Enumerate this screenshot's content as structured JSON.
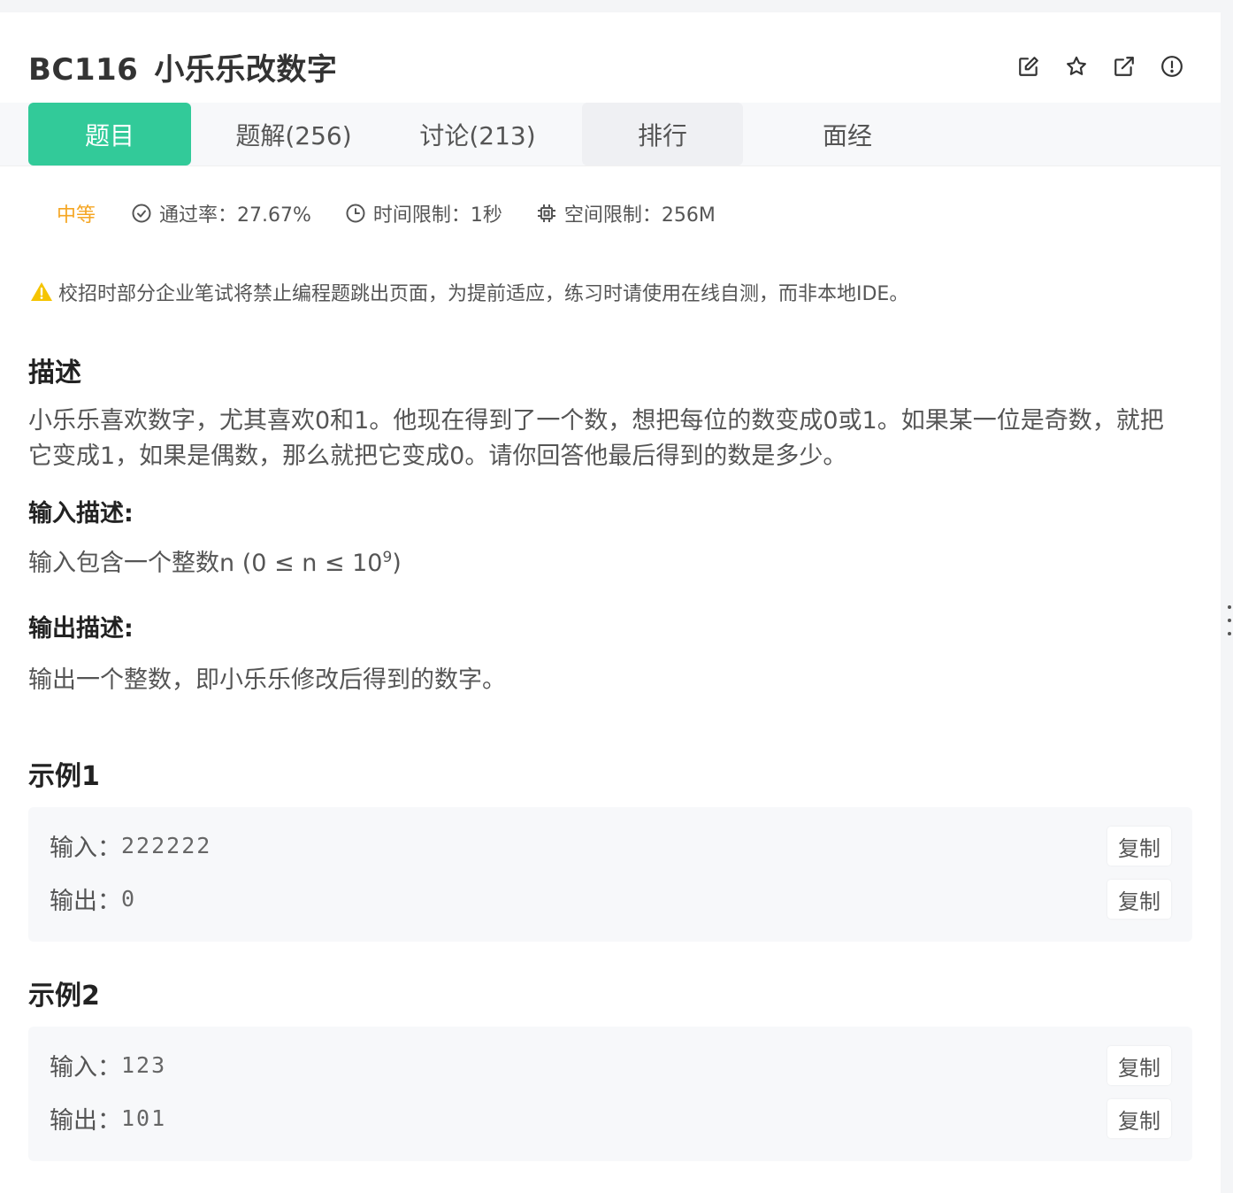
{
  "problem": {
    "id": "BC116",
    "title": "小乐乐改数字"
  },
  "toolbar": {
    "icons": [
      "edit-icon",
      "star-icon",
      "external-link-icon",
      "report-icon"
    ]
  },
  "tabs": [
    {
      "label": "题目",
      "active": true
    },
    {
      "label": "题解(256)"
    },
    {
      "label": "讨论(213)"
    },
    {
      "label": "排行"
    },
    {
      "label": "面经"
    }
  ],
  "meta": {
    "level": "中等",
    "pass_rate": "通过率：27.67%",
    "time_limit": "时间限制：1秒",
    "space_limit": "空间限制：256M"
  },
  "warning": "校招时部分企业笔试将禁止编程题跳出页面，为提前适应，练习时请使用在线自测，而非本地IDE。",
  "description": {
    "heading": "描述",
    "text": "小乐乐喜欢数字，尤其喜欢0和1。他现在得到了一个数，想把每位的数变成0或1。如果某一位是奇数，就把它变成1，如果是偶数，那么就把它变成0。请你回答他最后得到的数是多少。"
  },
  "input_desc": {
    "heading": "输入描述:",
    "text_prefix": "输入包含一个整数n (0 ≤ n ≤ 10",
    "sup": "9",
    "text_suffix": ")"
  },
  "output_desc": {
    "heading": "输出描述:",
    "text": "输出一个整数，即小乐乐修改后得到的数字。"
  },
  "examples": [
    {
      "heading": "示例1",
      "input_label": "输入：",
      "input": "222222",
      "output_label": "输出：",
      "output": "0",
      "copy_label": "复制"
    },
    {
      "heading": "示例2",
      "input_label": "输入：",
      "input": "123",
      "output_label": "输出：",
      "output": "101",
      "copy_label": "复制"
    }
  ],
  "colors": {
    "accent": "#32ca99",
    "level": "#f5a623",
    "warning": "#f5c400"
  }
}
